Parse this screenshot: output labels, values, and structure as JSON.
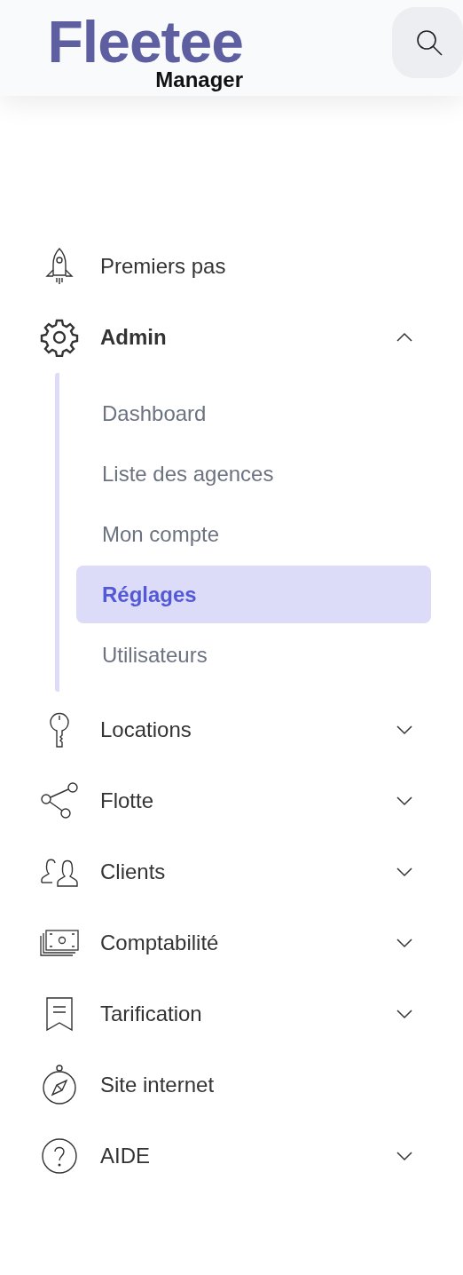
{
  "header": {
    "logo": {
      "name": "Fleetee",
      "tagline": "Manager"
    }
  },
  "menu": [
    {
      "kind": "link",
      "label": "Premiers pas"
    },
    {
      "kind": "group",
      "label": "Admin",
      "expanded": true,
      "children": [
        {
          "label": "Dashboard",
          "selected": false
        },
        {
          "label": "Liste des agences",
          "selected": false
        },
        {
          "label": "Mon compte",
          "selected": false
        },
        {
          "label": "Réglages",
          "selected": true
        },
        {
          "label": "Utilisateurs",
          "selected": false
        }
      ]
    },
    {
      "kind": "group",
      "label": "Locations",
      "expanded": false
    },
    {
      "kind": "group",
      "label": "Flotte",
      "expanded": false
    },
    {
      "kind": "group",
      "label": "Clients",
      "expanded": false
    },
    {
      "kind": "group",
      "label": "Comptabilité",
      "expanded": false
    },
    {
      "kind": "group",
      "label": "Tarification",
      "expanded": false
    },
    {
      "kind": "link",
      "label": "Site internet"
    },
    {
      "kind": "group",
      "label": "AIDE",
      "expanded": false
    }
  ]
}
